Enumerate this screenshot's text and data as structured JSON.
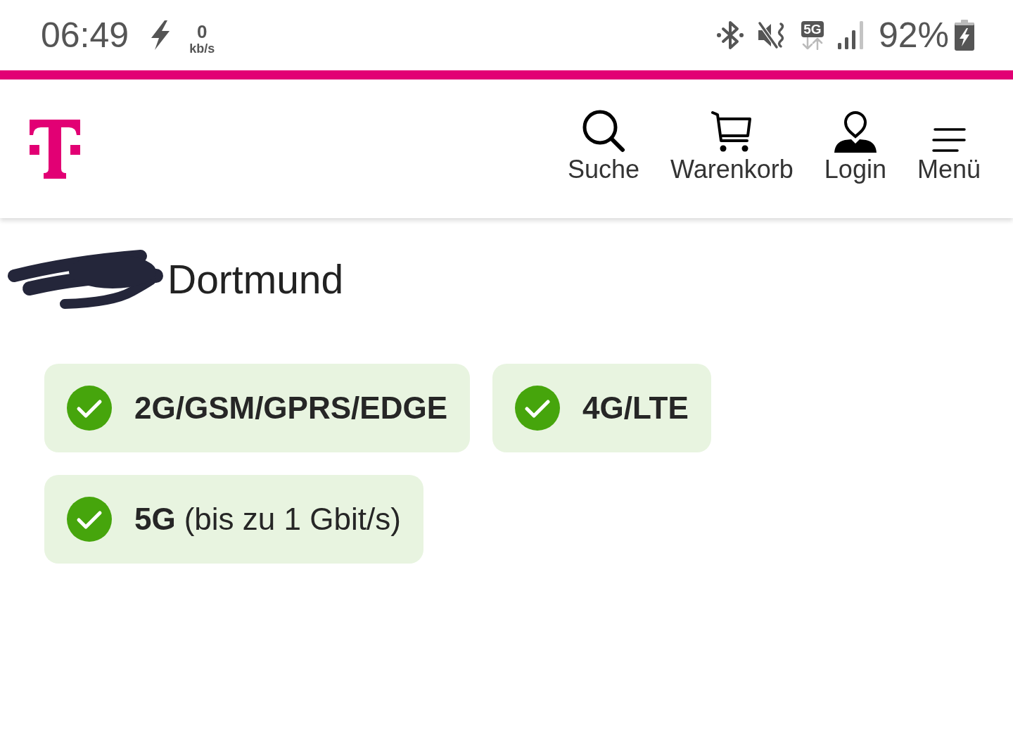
{
  "status_bar": {
    "time": "06:49",
    "charging": true,
    "speed_value": "0",
    "speed_unit": "kb/s",
    "network_type": "5G",
    "battery_percent": "92%"
  },
  "header": {
    "nav": [
      {
        "label": "Suche",
        "kind": "search"
      },
      {
        "label": "Warenkorb",
        "kind": "cart"
      },
      {
        "label": "Login",
        "kind": "user"
      },
      {
        "label": "Menü",
        "kind": "menu"
      }
    ]
  },
  "location": {
    "redacted": true,
    "city": "Dortmund"
  },
  "technologies": [
    {
      "name": "2G/GSM/GPRS/EDGE",
      "available": true
    },
    {
      "name": "4G/LTE",
      "available": true
    },
    {
      "name": "5G",
      "detail": "(bis zu 1 Gbit/s)",
      "available": true
    }
  ]
}
